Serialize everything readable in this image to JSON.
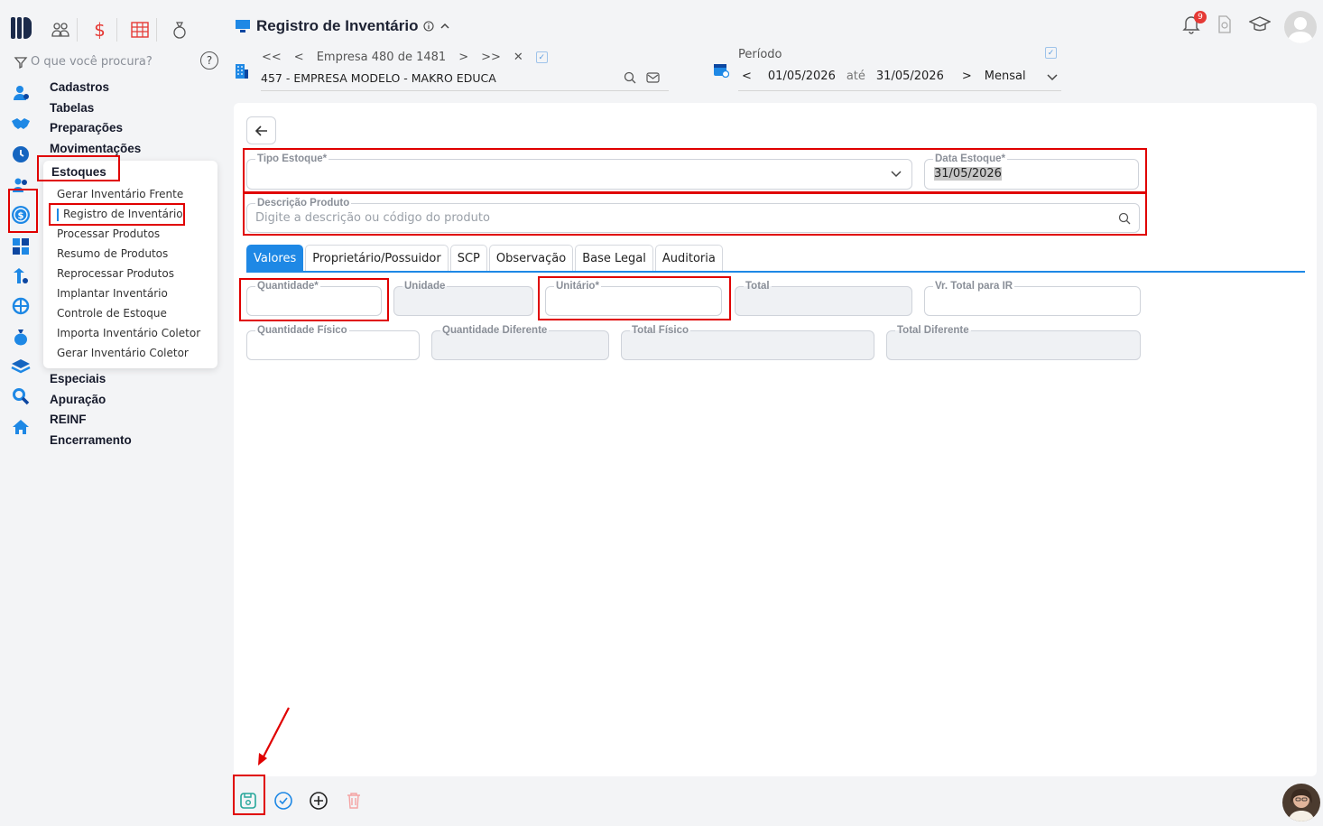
{
  "header": {
    "title": "Registro de Inventário",
    "nav_first": "<<",
    "nav_prev": "<",
    "empresa_counter": "Empresa 480 de 1481",
    "nav_next": ">",
    "nav_last": ">>",
    "nav_close": "✕",
    "company": "457 - EMPRESA MODELO - MAKRO EDUCA",
    "periodo_label": "Período",
    "date_start": "01/05/2026",
    "ate": "até",
    "date_end": "31/05/2026",
    "period_type": "Mensal",
    "notification_count": "9"
  },
  "sidebar": {
    "search_placeholder": "O que você procura?",
    "help": "?",
    "menu": [
      "Cadastros",
      "Tabelas",
      "Preparações",
      "Movimentações"
    ],
    "estoques": "Estoques",
    "submenu": [
      "Gerar Inventário Frente",
      "Registro de Inventário",
      "Processar Produtos",
      "Resumo de Produtos",
      "Reprocessar Produtos",
      "Implantar Inventário",
      "Controle de Estoque",
      "Importa Inventário Coletor",
      "Gerar Inventário Coletor"
    ],
    "menu_after": [
      "Especiais",
      "Apuração",
      "REINF",
      "Encerramento"
    ]
  },
  "form": {
    "tipo_estoque_label": "Tipo Estoque*",
    "data_estoque_label": "Data Estoque*",
    "data_estoque_value": "31/05/2026",
    "descricao_label": "Descrição Produto",
    "descricao_placeholder": "Digite a descrição ou código do produto",
    "tabs": [
      "Valores",
      "Proprietário/Possuidor",
      "SCP",
      "Observação",
      "Base Legal",
      "Auditoria"
    ],
    "quantidade": "Quantidade*",
    "unidade": "Unidade",
    "unitario": "Unitário*",
    "total": "Total",
    "vr_total_ir": "Vr. Total para IR",
    "quantidade_fisico": "Quantidade Físico",
    "quantidade_diferente": "Quantidade Diferente",
    "total_fisico": "Total Físico",
    "total_diferente": "Total Diferente"
  },
  "colors": {
    "accent": "#1e88e5",
    "highlight": "#e00000",
    "save": "#26a69a"
  }
}
